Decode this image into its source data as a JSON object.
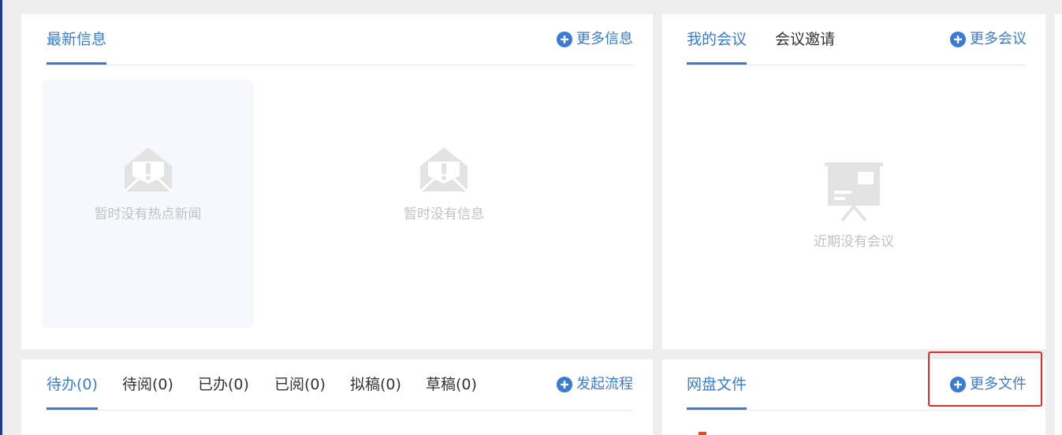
{
  "news_panel": {
    "tabs": [
      {
        "label": "最新信息",
        "active": true
      }
    ],
    "more_label": "更多信息",
    "hot_news_empty": "暂时没有热点新闻",
    "info_empty": "暂时没有信息"
  },
  "meeting_panel": {
    "tabs": [
      {
        "label": "我的会议",
        "active": true
      },
      {
        "label": "会议邀请",
        "active": false
      }
    ],
    "more_label": "更多会议",
    "empty_text": "近期没有会议"
  },
  "workflow_panel": {
    "tabs": [
      {
        "label": "待办(0)",
        "active": true
      },
      {
        "label": "待阅(0)",
        "active": false
      },
      {
        "label": "已办(0)",
        "active": false
      },
      {
        "label": "已阅(0)",
        "active": false
      },
      {
        "label": "拟稿(0)",
        "active": false
      },
      {
        "label": "草稿(0)",
        "active": false
      }
    ],
    "more_label": "发起流程"
  },
  "disk_panel": {
    "tabs": [
      {
        "label": "网盘文件",
        "active": true
      }
    ],
    "more_label": "更多文件"
  },
  "colors": {
    "accent": "#3a7bd5",
    "highlight": "#e52b2b",
    "empty_text": "#c2c2c2",
    "icon_gray": "#e3e3e3"
  },
  "icons": {
    "more": "plus-circle-icon",
    "news_empty": "envelope-alert-icon",
    "meeting_empty": "presentation-board-icon"
  }
}
